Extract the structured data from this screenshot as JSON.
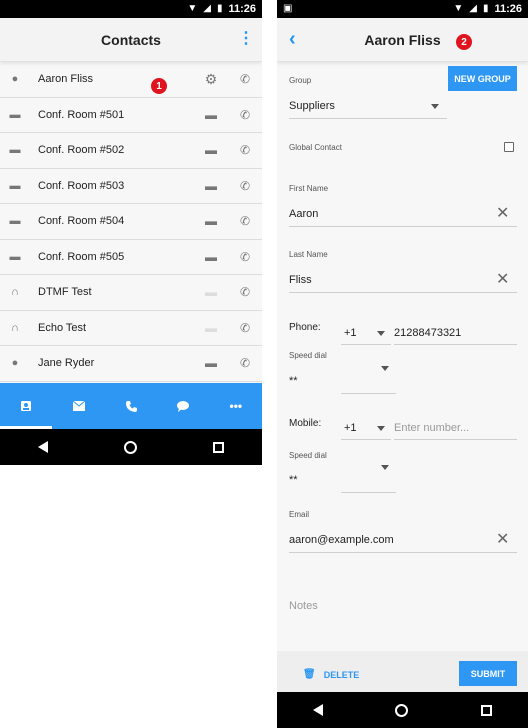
{
  "left": {
    "statusbar": {
      "time": "11:26"
    },
    "appbar": {
      "title": "Contacts",
      "menu_icon": "more-vert-icon"
    },
    "badge": "1",
    "contacts": [
      {
        "name": "Aaron Fliss",
        "kind_icon": "person-icon",
        "action1_icon": "gear-icon",
        "action1_dim": false
      },
      {
        "name": "Conf. Room #501",
        "kind_icon": "chat-icon",
        "action1_icon": "chat-icon",
        "action1_dim": false
      },
      {
        "name": "Conf. Room #502",
        "kind_icon": "chat-icon",
        "action1_icon": "chat-icon",
        "action1_dim": false
      },
      {
        "name": "Conf. Room #503",
        "kind_icon": "chat-icon",
        "action1_icon": "chat-icon",
        "action1_dim": false
      },
      {
        "name": "Conf. Room #504",
        "kind_icon": "chat-icon",
        "action1_icon": "chat-icon",
        "action1_dim": false
      },
      {
        "name": "Conf. Room #505",
        "kind_icon": "chat-icon",
        "action1_icon": "chat-icon",
        "action1_dim": false
      },
      {
        "name": "DTMF Test",
        "kind_icon": "headset-icon",
        "action1_icon": "chat-icon",
        "action1_dim": true
      },
      {
        "name": "Echo Test",
        "kind_icon": "headset-icon",
        "action1_icon": "chat-icon",
        "action1_dim": true
      },
      {
        "name": "Jane Ryder",
        "kind_icon": "person-icon",
        "action1_icon": "chat-icon",
        "action1_dim": false
      }
    ],
    "bottom_nav": [
      {
        "icon": "contacts-icon",
        "active": true
      },
      {
        "icon": "mail-icon",
        "active": false
      },
      {
        "icon": "phone-icon",
        "active": false
      },
      {
        "icon": "chat-icon",
        "active": false
      },
      {
        "icon": "more-horiz-icon",
        "active": false
      }
    ]
  },
  "right": {
    "statusbar": {
      "time": "11:26"
    },
    "appbar": {
      "title": "Aaron Fliss",
      "back_icon": "chevron-left-icon"
    },
    "badge": "2",
    "form": {
      "group_label": "Group",
      "group_value": "Suppliers",
      "new_group_button": "NEW GROUP",
      "global_contact_label": "Global Contact",
      "global_contact_checked": false,
      "first_name_label": "First Name",
      "first_name_value": "Aaron",
      "last_name_label": "Last Name",
      "last_name_value": "Fliss",
      "phone_label": "Phone:",
      "phone_country_code": "+1",
      "phone_number": "21288473321",
      "phone_speed_dial_label": "Speed dial",
      "phone_speed_dial_value": "**",
      "mobile_label": "Mobile:",
      "mobile_country_code": "+1",
      "mobile_placeholder": "Enter number...",
      "mobile_speed_dial_label": "Speed dial",
      "mobile_speed_dial_value": "**",
      "email_label": "Email",
      "email_value": "aaron@example.com",
      "notes_placeholder": "Notes"
    },
    "footer": {
      "delete_label": "DELETE",
      "submit_label": "SUBMIT"
    }
  }
}
